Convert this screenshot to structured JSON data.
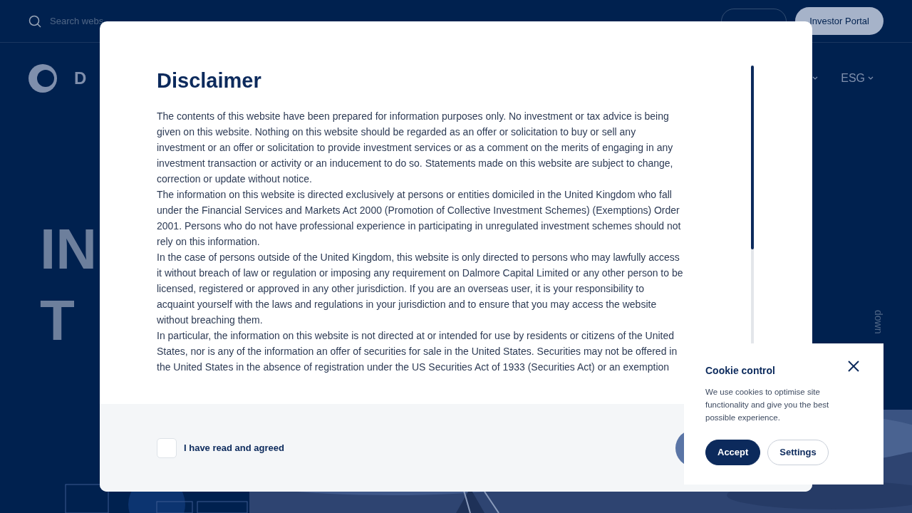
{
  "header": {
    "search": {
      "placeholder": "Search webs"
    },
    "investor_button": "Investor Portal"
  },
  "nav": {
    "logo_text": "D",
    "items": [
      {
        "kind": "hidden"
      },
      {
        "kind": "label",
        "label": "ESG"
      }
    ]
  },
  "hero": {
    "lines": [
      "IN",
      "T"
    ],
    "scroll_hint": "down"
  },
  "modal": {
    "title": "Disclaimer",
    "paragraphs": [
      "The contents of this website have been prepared for information purposes only. No investment or tax advice is being given on this website. Nothing on this website should be regarded as an offer or solicitation to buy or sell any investment or an offer or solicitation to provide investment services or as a comment on the merits of engaging in any investment transaction or activity or an inducement to do so. Statements made on this website are subject to change, correction or update without notice.",
      "The information on this website is directed exclusively at persons or entities domiciled in the United Kingdom who fall under the Financial Services and Markets Act 2000 (Promotion of Collective Investment Schemes) (Exemptions) Order 2001. Persons who do not have professional experience in participating in unregulated investment schemes should not rely on this information.",
      "In the case of persons outside of the United Kingdom, this website is only directed to persons who may lawfully access it without breach of law or regulation or imposing any requirement on Dalmore Capital Limited or any other person to be licensed, registered or approved in any other jurisdiction. If you are an overseas user, it is your responsibility to acquaint yourself with the laws and regulations in your jurisdiction and to ensure that you may access the website without breaching them.",
      "In particular, the information on this website is not directed at or intended for use by residents or citizens of the United States, nor is any of the information an offer of securities for sale in the United States. Securities may not be offered in the United States in the absence of registration under the US Securities Act of 1933 (Securities Act) or an exemption"
    ],
    "agree": {
      "label": "I have read and agreed",
      "checked": false
    }
  },
  "cookie": {
    "title": "Cookie control",
    "text": "We use cookies to optimise site functionality and give you the best possible experience.",
    "buttons": [
      {
        "label": "Accept",
        "kind": "primary"
      },
      {
        "label": "Settings",
        "kind": "secondary"
      }
    ]
  }
}
